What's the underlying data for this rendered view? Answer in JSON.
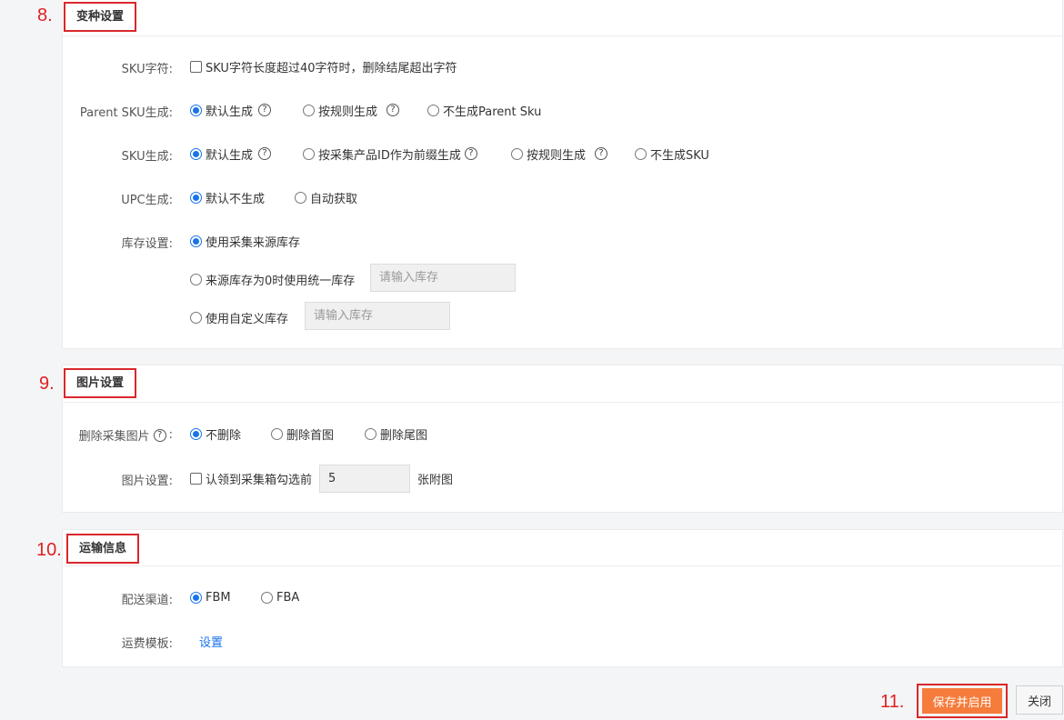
{
  "steps": {
    "s8": "8.",
    "s9": "9.",
    "s10": "10.",
    "s11": "11."
  },
  "variant": {
    "title": "变种设置",
    "sku_chars_label": "SKU字符:",
    "sku_chars_option": "SKU字符长度超过40字符时，删除结尾超出字符",
    "parent_sku_label": "Parent SKU生成:",
    "parent_sku_options": [
      "默认生成",
      "按规则生成",
      "不生成Parent Sku"
    ],
    "sku_gen_label": "SKU生成:",
    "sku_gen_options": [
      "默认生成",
      "按采集产品ID作为前缀生成",
      "按规则生成",
      "不生成SKU"
    ],
    "upc_label": "UPC生成:",
    "upc_options": [
      "默认不生成",
      "自动获取"
    ],
    "stock_label": "库存设置:",
    "stock_options": [
      "使用采集来源库存",
      "来源库存为0时使用统一库存",
      "使用自定义库存"
    ],
    "stock_placeholder": "请输入库存"
  },
  "image": {
    "title": "图片设置",
    "delete_label": "删除采集图片",
    "delete_colon": ":",
    "delete_options": [
      "不删除",
      "删除首图",
      "删除尾图"
    ],
    "setting_label": "图片设置:",
    "setting_option": "认领到采集箱勾选前",
    "setting_value": "5",
    "setting_suffix": "张附图"
  },
  "shipping": {
    "title": "运输信息",
    "channel_label": "配送渠道:",
    "channel_options": [
      "FBM",
      "FBA"
    ],
    "template_label": "运费模板:",
    "template_link": "设置"
  },
  "footer": {
    "save_label": "保存并启用",
    "close_label": "关闭"
  },
  "icons": {
    "help": "?"
  },
  "colors": {
    "accent": "#1a73e8",
    "save": "#f57c3b",
    "highlight": "#d9272b"
  }
}
